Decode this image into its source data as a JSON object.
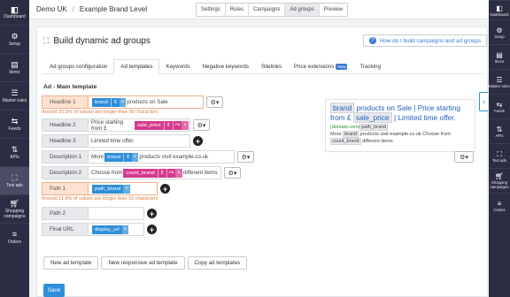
{
  "left_sidebar": [
    {
      "label": "Dashboard",
      "icon": "dashboard-icon"
    },
    {
      "label": "Setup",
      "icon": "gear-icon"
    },
    {
      "label": "Items",
      "icon": "items-icon"
    },
    {
      "label": "Master rules",
      "icon": "master-rules-icon"
    },
    {
      "label": "Feeds",
      "icon": "feeds-icon"
    },
    {
      "label": "APIs",
      "icon": "apis-icon"
    },
    {
      "label": "Text ads",
      "icon": "text-ads-icon"
    },
    {
      "label": "Shopping campaigns",
      "icon": "shopping-cart-icon"
    },
    {
      "label": "Orders",
      "icon": "orders-icon"
    }
  ],
  "right_sidebar": [
    {
      "label": "Dashboard"
    },
    {
      "label": "Setup"
    },
    {
      "label": "Items"
    },
    {
      "label": "Master rules"
    },
    {
      "label": "Feeds"
    },
    {
      "label": "APIs"
    },
    {
      "label": "Text ads"
    },
    {
      "label": "Shopping campaigns"
    },
    {
      "label": "Orders"
    }
  ],
  "topbar": {
    "account": "Demo UK",
    "separator": "/",
    "campaign": "Example Brand Level",
    "steps": [
      "Settings",
      "Rules",
      "Campaigns",
      "Ad groups",
      "Preview"
    ],
    "active_step": "Ad groups"
  },
  "page": {
    "title": "Build dynamic ad groups",
    "help_label": "How do I build campaigns and ad groups",
    "tabs": [
      "Ad groups configuration",
      "Ad templates",
      "Keywords",
      "Negative keywords",
      "Sitelinks",
      "Price extensions",
      "Tracking"
    ],
    "new_badge": "New",
    "section": "Ad - Main template"
  },
  "form": {
    "headline1": {
      "label": "Headline 1",
      "token": "brand",
      "after": "products on Sale",
      "note": "Around 25.5% of values are longer than 30 characters"
    },
    "headline2": {
      "label": "Headline 2",
      "before": "Price starting from £",
      "token": "sale_price"
    },
    "headline3": {
      "label": "Headline 3",
      "text": "Limited time offer."
    },
    "description1": {
      "label": "Description 1",
      "before": "More",
      "token": "brand",
      "after": "products visit example.co.uk"
    },
    "description2": {
      "label": "Description 2",
      "before": "Choose from",
      "token": "count_brand",
      "after": "different items"
    },
    "path1": {
      "label": "Path 1",
      "token": "path_brand",
      "note": "Around 11.8% of values are longer than 15 characters"
    },
    "path2": {
      "label": "Path 2"
    },
    "final_url": {
      "label": "Final URL",
      "token": "display_url"
    },
    "token_case_label": "Aa",
    "token_remove": "×",
    "token_change": "⇕"
  },
  "preview": {
    "t1": "brand",
    "t2": "products on Sale | Price starting from £",
    "t3": "sale_price",
    "t4": "| Limited time offer.",
    "url_prefix": "(domain.com/",
    "url_token": "path_brand",
    "desc1": "More",
    "desc_token1": "brand",
    "desc2": "products visit example.co.uk Choose from",
    "desc_token2": "count_brand",
    "desc3": "different items"
  },
  "buttons": {
    "new_ad": "New ad template",
    "new_responsive": "New responsive ad template",
    "copy": "Copy ad templates",
    "save": "Save"
  },
  "colors": {
    "token_blue": "#2d8fd8",
    "token_pink": "#d63a8e",
    "sidebar": "#2b2d42",
    "warn": "#f4b089"
  }
}
